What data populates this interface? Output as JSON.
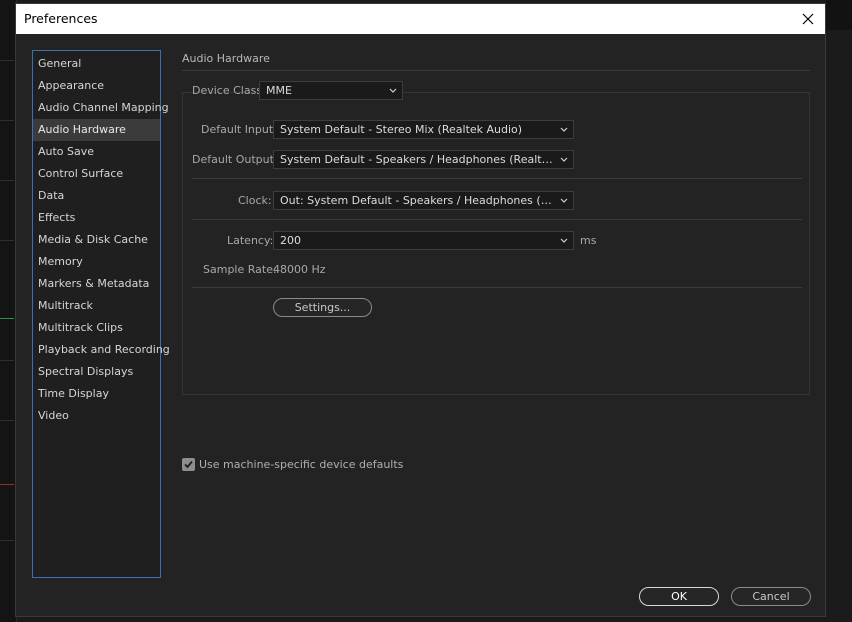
{
  "window": {
    "title": "Preferences",
    "close_icon": "close-icon"
  },
  "sidebar": {
    "items": [
      {
        "label": "General"
      },
      {
        "label": "Appearance"
      },
      {
        "label": "Audio Channel Mapping"
      },
      {
        "label": "Audio Hardware",
        "selected": true
      },
      {
        "label": "Auto Save"
      },
      {
        "label": "Control Surface"
      },
      {
        "label": "Data"
      },
      {
        "label": "Effects"
      },
      {
        "label": "Media & Disk Cache"
      },
      {
        "label": "Memory"
      },
      {
        "label": "Markers & Metadata"
      },
      {
        "label": "Multitrack"
      },
      {
        "label": "Multitrack Clips"
      },
      {
        "label": "Playback and Recording"
      },
      {
        "label": "Spectral Displays"
      },
      {
        "label": "Time Display"
      },
      {
        "label": "Video"
      }
    ]
  },
  "main": {
    "section_title": "Audio Hardware",
    "device_class": {
      "label": "Device Class:",
      "value": "MME"
    },
    "default_input": {
      "label": "Default Input:",
      "value": "System Default - Stereo Mix (Realtek Audio)"
    },
    "default_output": {
      "label": "Default Output:",
      "value": "System Default - Speakers / Headphones (Realtek Aud..."
    },
    "clock": {
      "label": "Clock:",
      "value": "Out: System Default - Speakers / Headphones (Realtek..."
    },
    "latency": {
      "label": "Latency:",
      "value": "200",
      "unit": "ms"
    },
    "sample_rate": {
      "label": "Sample Rate:",
      "value": "48000 Hz"
    },
    "settings_button": "Settings...",
    "machine_defaults": {
      "label": "Use machine-specific device defaults",
      "checked": true
    }
  },
  "footer": {
    "ok_label": "OK",
    "cancel_label": "Cancel"
  },
  "colors": {
    "selection_border": "#3b6fb0",
    "dialog_bg": "#232323"
  }
}
